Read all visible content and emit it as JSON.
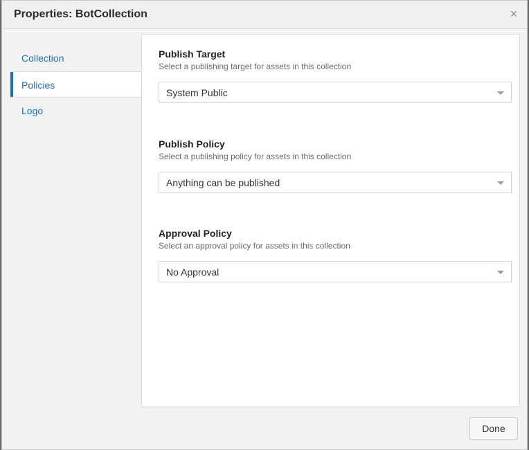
{
  "dialog": {
    "title": "Properties: BotCollection",
    "close_icon": "close-icon",
    "close_glyph": "×"
  },
  "nav": {
    "items": [
      {
        "label": "Collection",
        "active": false
      },
      {
        "label": "Policies",
        "active": true
      },
      {
        "label": "Logo",
        "active": false
      }
    ]
  },
  "sections": {
    "publish_target": {
      "title": "Publish Target",
      "description": "Select a publishing target for assets in this collection",
      "value": "System Public"
    },
    "publish_policy": {
      "title": "Publish Policy",
      "description": "Select a publishing policy for assets in this collection",
      "value": "Anything can be published"
    },
    "approval_policy": {
      "title": "Approval Policy",
      "description": "Select an approval policy for assets in this collection",
      "value": "No Approval"
    }
  },
  "footer": {
    "done_label": "Done"
  },
  "colors": {
    "accent": "#1f6fb2",
    "background": "#f2f2f2",
    "panel": "#ffffff"
  }
}
